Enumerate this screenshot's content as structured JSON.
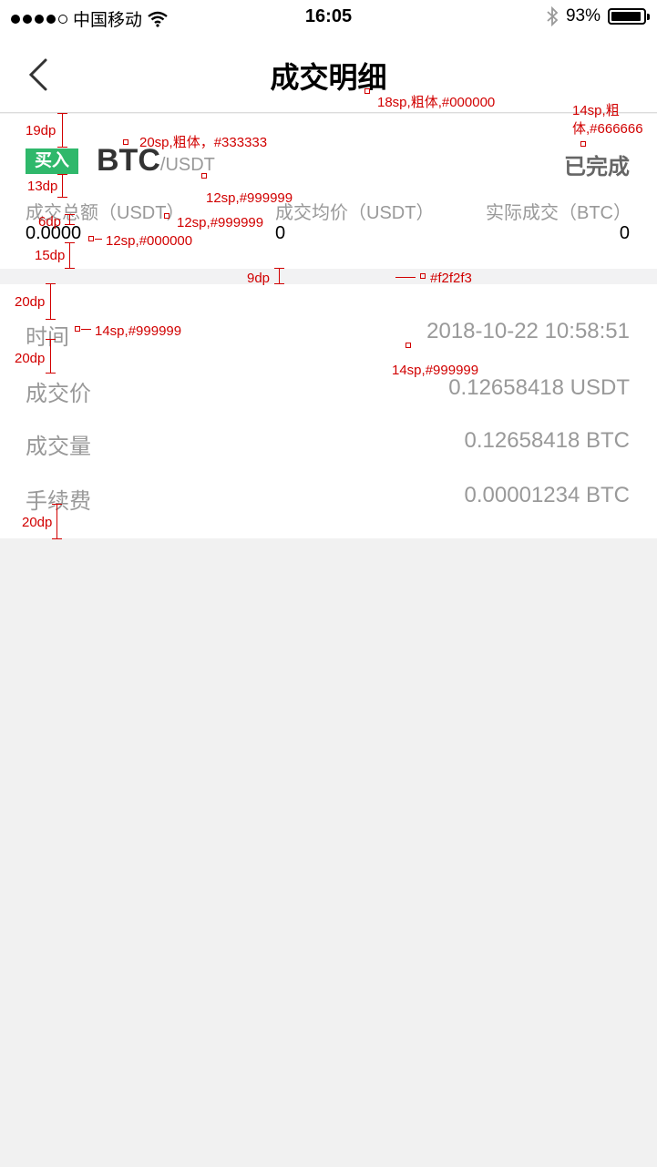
{
  "status_bar": {
    "carrier": "中国移动",
    "time": "16:05",
    "battery_text": "93%",
    "battery_level": 0.93,
    "icons": [
      "signal-dots-icon",
      "wifi-icon",
      "bluetooth-icon",
      "battery-icon"
    ]
  },
  "nav": {
    "title": "成交明细",
    "back_icon": "chevron-left-icon"
  },
  "summary": {
    "side_badge": "买入",
    "badge_color": "#2fb86b",
    "base_symbol": "BTC",
    "quote_symbol": "/USDT",
    "status": "已完成",
    "stats": [
      {
        "label": "成交总额（USDT）",
        "value": "0.0000"
      },
      {
        "label": "成交均价（USDT）",
        "value": "0"
      },
      {
        "label": "实际成交（BTC）",
        "value": "0"
      }
    ]
  },
  "details": {
    "rows": [
      {
        "label": "时间",
        "value": "2018-10-22 10:58:51"
      },
      {
        "label": "成交价",
        "value": "0.12658418 USDT"
      },
      {
        "label": "成交量",
        "value": "0.12658418 BTC"
      },
      {
        "label": "手续费",
        "value": "0.00001234 BTC"
      }
    ]
  },
  "annotations": {
    "title_spec": "18sp,粗体,#000000",
    "status_spec_line1": "14sp,粗",
    "status_spec_line2": "体,#666666",
    "pair_spec": "20sp,粗体，#333333",
    "gap_19": "19dp",
    "gap_13": "13dp",
    "gap_6": "6dp",
    "gap_15": "15dp",
    "quote_spec": "12sp,#999999",
    "stat_label_spec": "12sp,#999999",
    "stat_value_spec": "12sp,#000000",
    "sep_gap": "9dp",
    "sep_color": "#f2f2f3",
    "gap_20_a": "20dp",
    "gap_20_b": "20dp",
    "gap_20_c": "20dp",
    "label_spec": "14sp,#999999",
    "value_spec": "14sp,#999999"
  },
  "colors": {
    "accent_green": "#2fb86b",
    "annotation_red": "#d10000",
    "page_bg": "#f1f1f1"
  }
}
